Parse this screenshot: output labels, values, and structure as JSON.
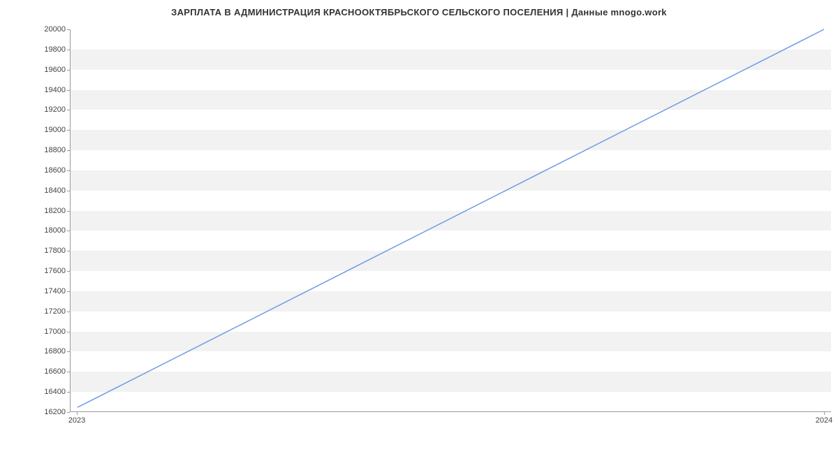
{
  "chart_data": {
    "type": "line",
    "title": "ЗАРПЛАТА В АДМИНИСТРАЦИЯ КРАСНООКТЯБРЬСКОГО СЕЛЬСКОГО ПОСЕЛЕНИЯ | Данные mnogo.work",
    "xlabel": "",
    "ylabel": "",
    "x": [
      "2023",
      "2024"
    ],
    "values": [
      16240,
      20000
    ],
    "ylim": [
      16200,
      20000
    ],
    "yticks": [
      16200,
      16400,
      16600,
      16800,
      17000,
      17200,
      17400,
      17600,
      17800,
      18000,
      18200,
      18400,
      18600,
      18800,
      19000,
      19200,
      19400,
      19600,
      19800,
      20000
    ],
    "line_color": "#6f9ae8",
    "band_color": "#f2f2f2"
  }
}
